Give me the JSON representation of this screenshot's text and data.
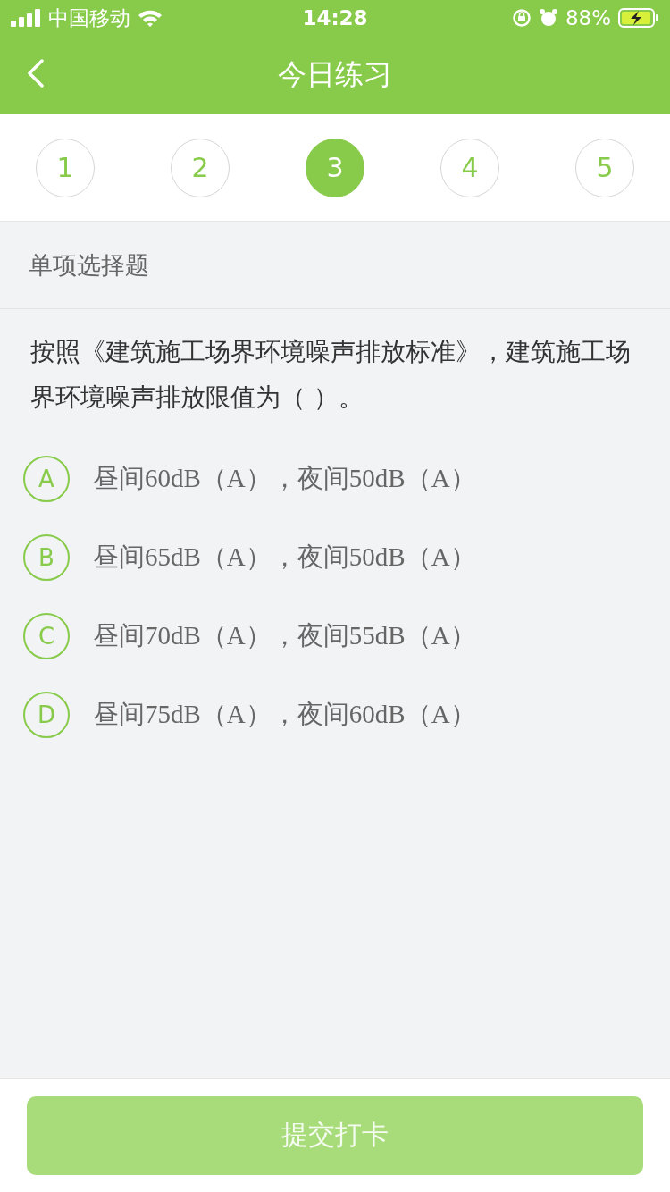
{
  "status_bar": {
    "carrier": "中国移动",
    "time": "14:28",
    "battery": "88%"
  },
  "header": {
    "title": "今日练习"
  },
  "steps": [
    {
      "label": "1",
      "selected": false
    },
    {
      "label": "2",
      "selected": false
    },
    {
      "label": "3",
      "selected": true
    },
    {
      "label": "4",
      "selected": false
    },
    {
      "label": "5",
      "selected": false
    }
  ],
  "section": {
    "title": "单项选择题"
  },
  "question": {
    "text": "按照《建筑施工场界环境噪声排放标准》，建筑施工场界环境噪声排放限值为（ ）。",
    "options": [
      {
        "letter": "A",
        "text": "昼间60dB（A），夜间50dB（A）",
        "selected": false
      },
      {
        "letter": "B",
        "text": "昼间65dB（A），夜间50dB（A）",
        "selected": false
      },
      {
        "letter": "C",
        "text": "昼间70dB（A），夜间55dB（A）",
        "selected": false
      },
      {
        "letter": "D",
        "text": "昼间75dB（A），夜间60dB（A）",
        "selected": false
      }
    ]
  },
  "submit": {
    "label": "提交打卡",
    "disabled": true
  }
}
